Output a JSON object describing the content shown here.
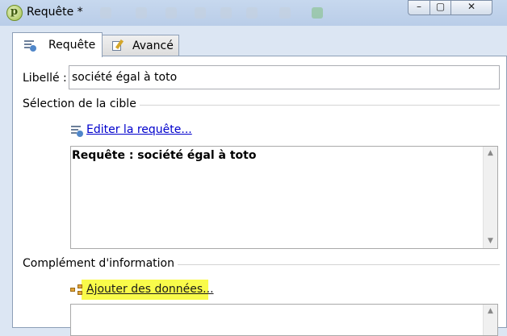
{
  "window": {
    "title": "Requête *"
  },
  "window_controls": {
    "minimize": "–",
    "maximize": "▢",
    "close": "✕"
  },
  "tabs": [
    {
      "label": "Requête",
      "icon": "query-icon",
      "active": true
    },
    {
      "label": "Avancé",
      "icon": "advanced-settings-icon",
      "active": false
    }
  ],
  "form": {
    "libelle_label": "Libellé :",
    "libelle_value": "société égal à toto"
  },
  "target_selection": {
    "title": "Sélection de la cible",
    "edit_link": "Editer la requête...",
    "query_text": "Requête : société égal à toto"
  },
  "additional_info": {
    "title": "Complément d'information",
    "add_link": "Ajouter des données..."
  },
  "colors": {
    "highlight": "#f9fb4a",
    "link": "#0000cc",
    "titlebar": "#c7d8ee"
  }
}
